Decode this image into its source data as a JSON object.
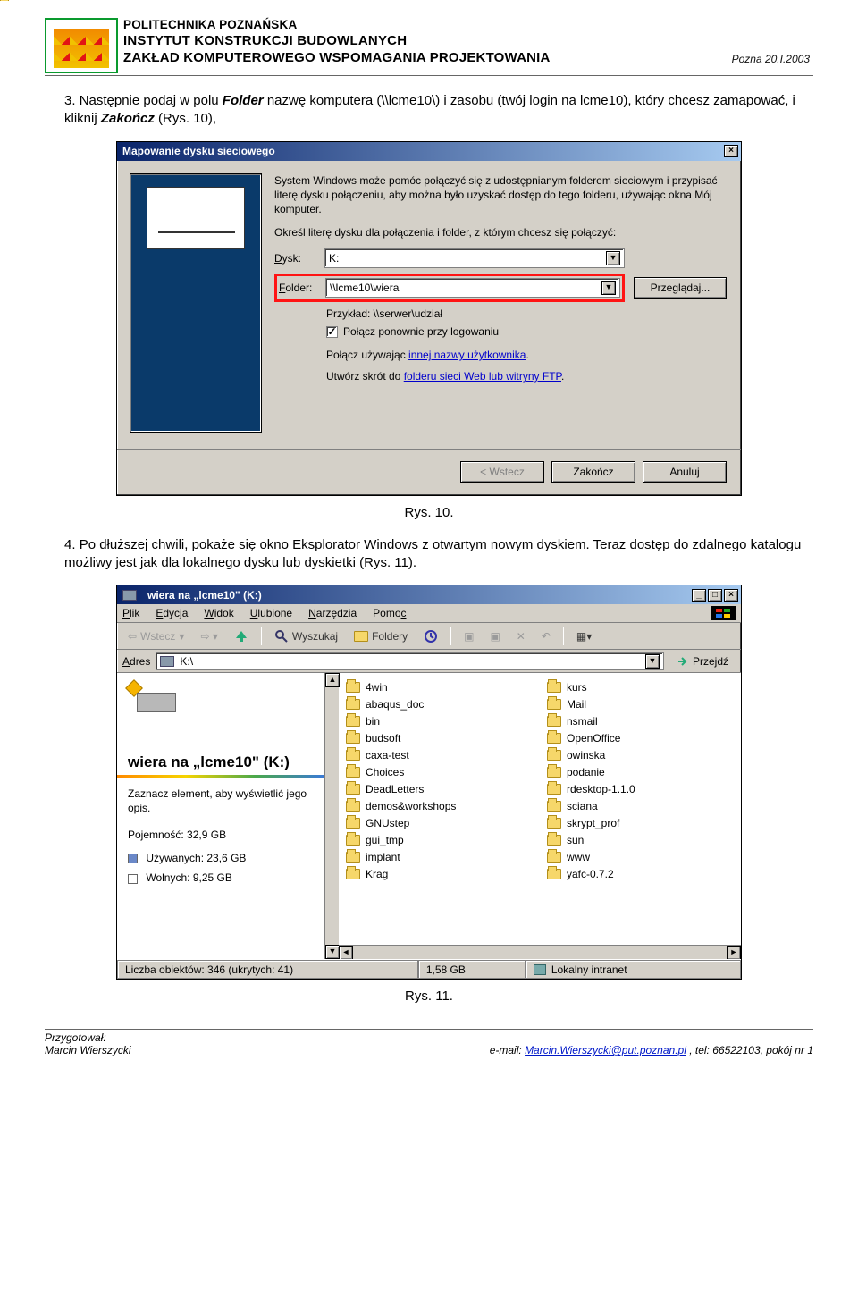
{
  "header": {
    "line1": "POLITECHNIKA POZNAŃSKA",
    "line2": "INSTYTUT KONSTRUKCJI BUDOWLANYCH",
    "line3": "ZAKŁAD KOMPUTEROWEGO WSPOMAGANIA PROJEKTOWANIA",
    "date": "Pozna  20.I.2003"
  },
  "step3": {
    "num": "3.",
    "text_a": "Następnie podaj w polu ",
    "field": "Folder",
    "text_b": " nazwę komputera (\\\\lcme10\\) i zasobu (twój login na lcme10), który chcesz zamapować, i kliknij ",
    "btn": "Zakończ",
    "text_c": " (Rys. 10),"
  },
  "dlg": {
    "title": "Mapowanie dysku sieciowego",
    "para1": "System Windows może pomóc połączyć się z udostępnianym folderem sieciowym i przypisać literę dysku połączeniu, aby można było uzyskać dostęp do tego folderu, używając okna Mój komputer.",
    "para2": "Określ literę dysku dla połączenia i folder, z którym chcesz się połączyć:",
    "labels": {
      "dysk": "Dysk:",
      "folder": "Folder:"
    },
    "values": {
      "dysk": "K:",
      "folder": "\\\\lcme10\\wiera"
    },
    "browse": "Przeglądaj...",
    "example": "Przykład: \\\\serwer\\udział",
    "checkbox": "Połącz ponownie przy logowaniu",
    "connect_line_a": "Połącz używając ",
    "connect_link": "innej nazwy użytkownika",
    "shortcut_line_a": "Utwórz skrót do ",
    "shortcut_link": "folderu sieci Web lub witryny FTP",
    "buttons": {
      "back": "< Wstecz",
      "finish": "Zakończ",
      "cancel": "Anuluj"
    }
  },
  "caption1": "Rys. 10.",
  "step4": {
    "num": "4.",
    "text": "Po dłuższej chwili, pokaże się okno Eksplorator Windows z otwartym nowym dyskiem. Teraz dostęp do zdalnego katalogu możliwy jest jak dla lokalnego dysku lub dyskietki (Rys. 11)."
  },
  "explorer": {
    "title": "wiera na „lcme10\" (K:)",
    "menus": [
      "Plik",
      "Edycja",
      "Widok",
      "Ulubione",
      "Narzędzia",
      "Pomoc"
    ],
    "toolbar": {
      "back": "Wstecz",
      "search": "Wyszukaj",
      "folders": "Foldery"
    },
    "address_label": "Adres",
    "address_value": "K:\\",
    "go": "Przejdź",
    "side_title": "wiera na „lcme10\" (K:)",
    "side_hint": "Zaznacz element, aby wyświetlić jego opis.",
    "capacity_label": "Pojemność:",
    "capacity_value": "32,9 GB",
    "used_label": "Używanych:",
    "used_value": "23,6 GB",
    "free_label": "Wolnych:",
    "free_value": "9,25 GB",
    "folders_col1": [
      "4win",
      "abaqus_doc",
      "bin",
      "budsoft",
      "caxa-test",
      "Choices",
      "DeadLetters",
      "demos&workshops",
      "GNUstep",
      "gui_tmp",
      "implant",
      "Krag"
    ],
    "folders_col2": [
      "kurs",
      "Mail",
      "nsmail",
      "OpenOffice",
      "owinska",
      "podanie",
      "rdesktop-1.1.0",
      "sciana",
      "skrypt_prof",
      "sun",
      "www",
      "yafc-0.7.2"
    ],
    "status": {
      "objects": "Liczba obiektów: 346 (ukrytych: 41)",
      "size": "1,58 GB",
      "zone": "Lokalny intranet"
    }
  },
  "caption2": "Rys. 11.",
  "footer": {
    "left1": "Przygotował:",
    "left2": "Marcin Wierszycki",
    "right_a": "e-mail: ",
    "email": "Marcin.Wierszycki@put.poznan.pl",
    "right_b": ",    tel: 66522103, pokój nr 1"
  }
}
